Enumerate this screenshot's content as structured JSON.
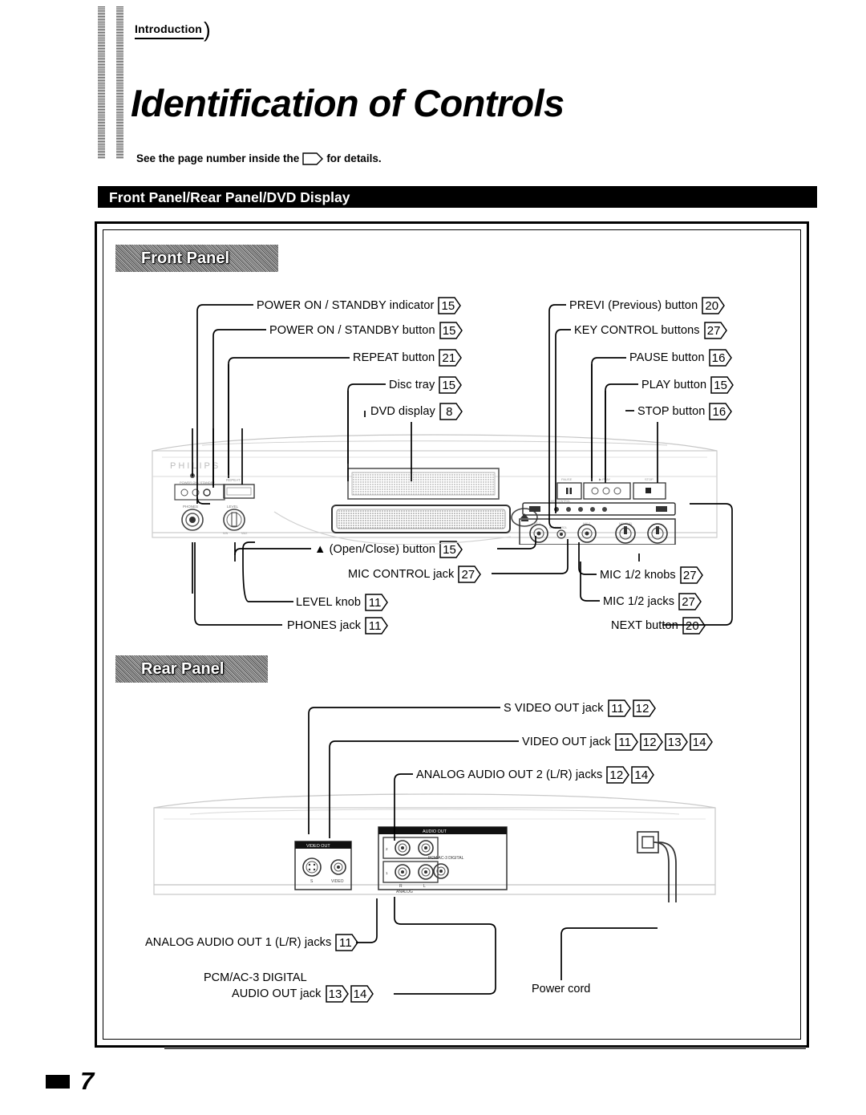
{
  "header": {
    "chapter_tag": "Introduction",
    "title": "Identification of Controls",
    "note_prefix": "See the page number inside the",
    "note_suffix": "for details.",
    "section_bar": "Front Panel/Rear Panel/DVD Display"
  },
  "front_panel": {
    "heading": "Front Panel",
    "left_callouts": [
      {
        "label": "POWER ON / STANDBY indicator",
        "pages": [
          "15"
        ]
      },
      {
        "label": "POWER ON / STANDBY button",
        "pages": [
          "15"
        ]
      },
      {
        "label": "REPEAT button",
        "pages": [
          "21"
        ]
      },
      {
        "label": "Disc tray",
        "pages": [
          "15"
        ]
      },
      {
        "label": "DVD display",
        "pages": [
          "8"
        ]
      }
    ],
    "right_callouts": [
      {
        "label": "PREVI (Previous) button",
        "pages": [
          "20"
        ]
      },
      {
        "label": "KEY CONTROL buttons",
        "pages": [
          "27"
        ]
      },
      {
        "label": "PAUSE  button",
        "pages": [
          "16"
        ]
      },
      {
        "label": "PLAY button",
        "pages": [
          "15"
        ]
      },
      {
        "label": "STOP button",
        "pages": [
          "16"
        ]
      }
    ],
    "bottom_left_callouts": [
      {
        "label": "▲ (Open/Close) button",
        "pages": [
          "15"
        ]
      },
      {
        "label": "MIC CONTROL jack",
        "pages": [
          "27"
        ]
      },
      {
        "label": "LEVEL knob",
        "pages": [
          "11"
        ]
      },
      {
        "label": "PHONES jack",
        "pages": [
          "11"
        ]
      }
    ],
    "bottom_right_callouts": [
      {
        "label": "MIC 1/2 knobs",
        "pages": [
          "27"
        ]
      },
      {
        "label": "MIC 1/2 jacks",
        "pages": [
          "27"
        ]
      },
      {
        "label": "NEXT button",
        "pages": [
          "20"
        ]
      }
    ],
    "device_markings": {
      "brand": "PHILIPS",
      "power_label": "POWER ON / STANDBY",
      "repeat_label": "REPEAT",
      "phones_label": "PHONES",
      "level_label": "LEVEL",
      "level_min": "MIN",
      "level_max": "MAX",
      "pause_label": "PAUSE",
      "play_label": "PLAY",
      "stop_label": "STOP",
      "mic1_label": "MIC 1",
      "mic2_label": "MIC 2",
      "mic_control_label": "MIC CONTROL",
      "key_control_label": "KEY CONTROL"
    }
  },
  "rear_panel": {
    "heading": "Rear Panel",
    "top_callouts": [
      {
        "label": "S VIDEO OUT jack",
        "pages": [
          "11",
          "12"
        ]
      },
      {
        "label": "VIDEO OUT jack",
        "pages": [
          "11",
          "12",
          "13",
          "14"
        ]
      },
      {
        "label": "ANALOG AUDIO OUT 2 (L/R) jacks",
        "pages": [
          "12",
          "14"
        ]
      }
    ],
    "bottom_callouts": [
      {
        "label": "ANALOG AUDIO OUT 1 (L/R) jacks",
        "pages": [
          "11"
        ]
      },
      {
        "label_line1": "PCM/AC-3 DIGITAL",
        "label": "AUDIO OUT jack",
        "pages": [
          "13",
          "14"
        ]
      }
    ],
    "power_cord_label": "Power cord",
    "device_markings": {
      "video_out": "VIDEO OUT",
      "s_label": "S",
      "video_label": "VIDEO",
      "audio_out": "AUDIO OUT",
      "analog_label": "ANALOG",
      "r_label": "R",
      "l_label": "L",
      "row1": "1",
      "row2": "2",
      "digital_label": "PCM/AC-3 DIGITAL"
    }
  },
  "footer": {
    "page_number": "7"
  },
  "colors": {
    "ink": "#000000",
    "paper": "#ffffff",
    "halftone": "#6a6a6a"
  }
}
